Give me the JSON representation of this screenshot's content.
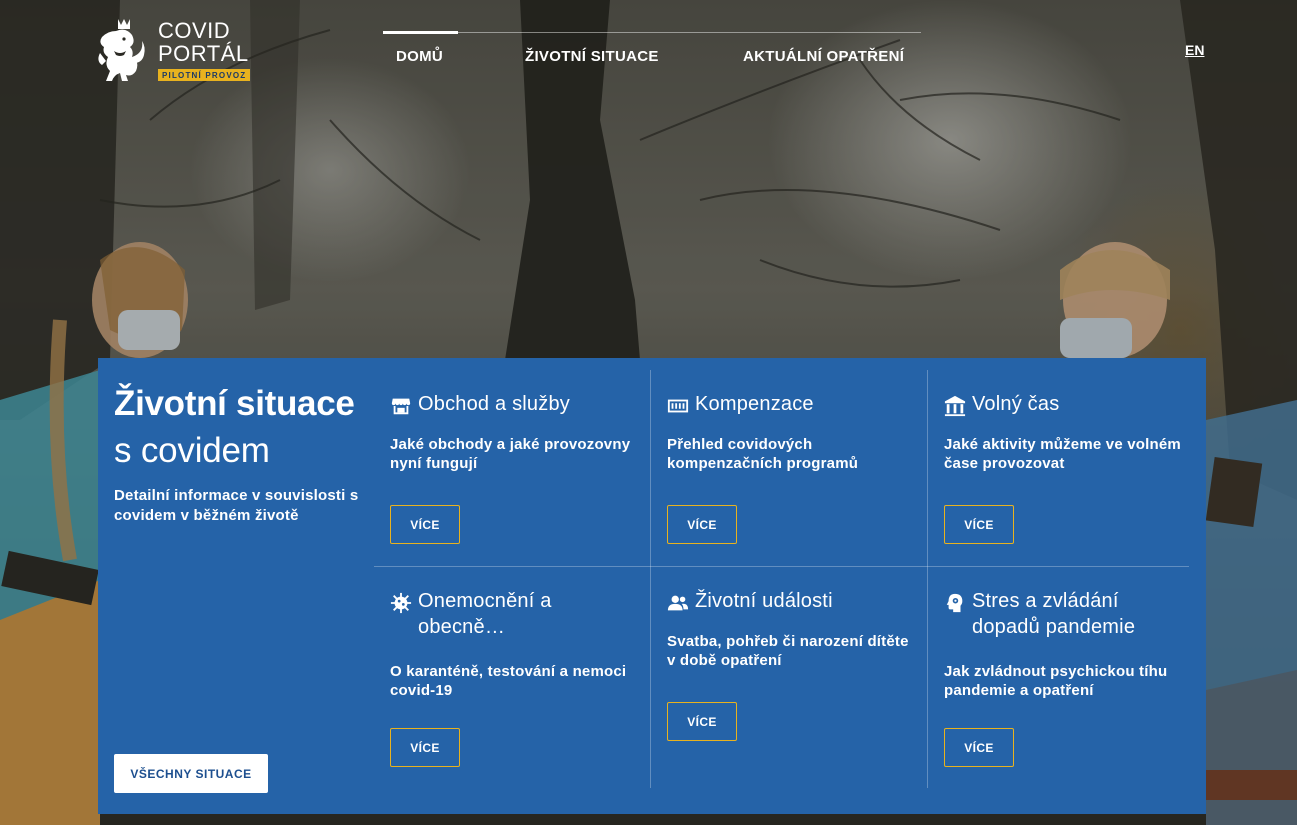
{
  "header": {
    "logo_line1": "COVID",
    "logo_line2": "PORTÁL",
    "logo_badge": "PILOTNÍ PROVOZ",
    "nav": [
      {
        "label": "DOMŮ",
        "active": true
      },
      {
        "label": "ŽIVOTNÍ SITUACE",
        "active": false
      },
      {
        "label": "AKTUÁLNÍ OPATŘENÍ",
        "active": false
      }
    ],
    "language": "EN"
  },
  "panel": {
    "title": "Životní situace",
    "subtitle": "s covidem",
    "description": "Detailní informace v souvislosti s covidem v běžném životě",
    "all_button": "VŠECHNY SITUACE",
    "tiles": [
      {
        "title": "Obchod a služby",
        "description": "Jaké obchody a jaké provozovny nyní fungují",
        "button": "VÍCE",
        "icon": "store-icon"
      },
      {
        "title": "Kompenzace",
        "description": "Přehled covidových kompenzačních programů",
        "button": "VÍCE",
        "icon": "money-icon"
      },
      {
        "title": "Volný čas",
        "description": "Jaké aktivity můžeme ve volném čase provozovat",
        "button": "VÍCE",
        "icon": "museum-icon"
      },
      {
        "title": "Onemocnění a obecně…",
        "description": "O karanténě, testování a nemoci covid-19",
        "button": "VÍCE",
        "icon": "virus-icon"
      },
      {
        "title": "Životní události",
        "description": "Svatba, pohřeb či narození dítěte v době opatření",
        "button": "VÍCE",
        "icon": "people-icon"
      },
      {
        "title": "Stres a zvládání dopadů pandemie",
        "description": "Jak zvládnout psychickou tíhu pandemie a opatření",
        "button": "VÍCE",
        "icon": "mind-icon"
      }
    ]
  },
  "colors": {
    "panel_blue": "#2563a8",
    "accent_yellow": "#e8b21f",
    "button_text_blue": "#1d4f8f"
  }
}
